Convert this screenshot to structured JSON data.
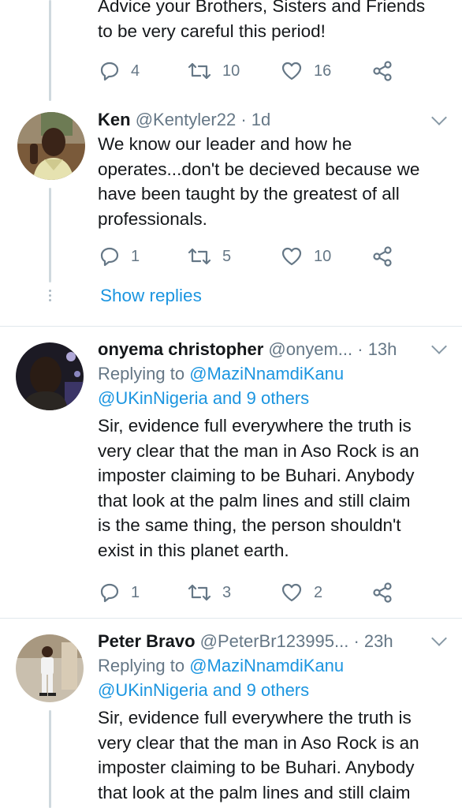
{
  "tweet0": {
    "text_lines": [
      "Advice your Brothers, Sisters and Friends",
      "to be very careful this period!"
    ],
    "replies": "4",
    "retweets": "10",
    "likes": "16"
  },
  "tweet1": {
    "name": "Ken",
    "handle": "@Kentyler22",
    "dot": "·",
    "time": "1d",
    "text_lines": [
      "We know our leader and how he",
      "operates...don't be decieved because we",
      "have been taught by the greatest of all",
      "professionals."
    ],
    "replies": "1",
    "retweets": "5",
    "likes": "10",
    "show_replies": "Show replies"
  },
  "tweet2": {
    "name": "onyema christopher",
    "handle": "@onyem...",
    "dot": "·",
    "time": "13h",
    "replying_prefix": "Replying to ",
    "replying_to": "@MaziNnamdiKanu",
    "replying_line2": "@UKinNigeria and 9 others",
    "text_lines": [
      "Sir, evidence full everywhere the truth is",
      "very clear that the man in Aso Rock is an",
      "imposter claiming to be Buhari. Anybody",
      "that look at the palm lines and still claim",
      "is the same thing, the person shouldn't",
      "exist in this planet earth."
    ],
    "replies": "1",
    "retweets": "3",
    "likes": "2"
  },
  "tweet3": {
    "name": "Peter Bravo",
    "handle": "@PeterBr123995...",
    "dot": "·",
    "time": "23h",
    "replying_prefix": "Replying to ",
    "replying_to": "@MaziNnamdiKanu",
    "replying_line2": "@UKinNigeria and 9 others",
    "text_lines": [
      "Sir, evidence full everywhere the truth is",
      "very clear that the man in Aso Rock is an",
      "imposter claiming to be Buhari. Anybody",
      "that look at the palm lines and still claim"
    ]
  },
  "icons": {
    "reply": "reply-icon",
    "retweet": "retweet-icon",
    "like": "heart-icon",
    "share": "share-icon",
    "more": "chevron-down-icon"
  },
  "colors": {
    "link": "#1b95e0",
    "muted": "#657786",
    "line": "#cfd9de"
  }
}
